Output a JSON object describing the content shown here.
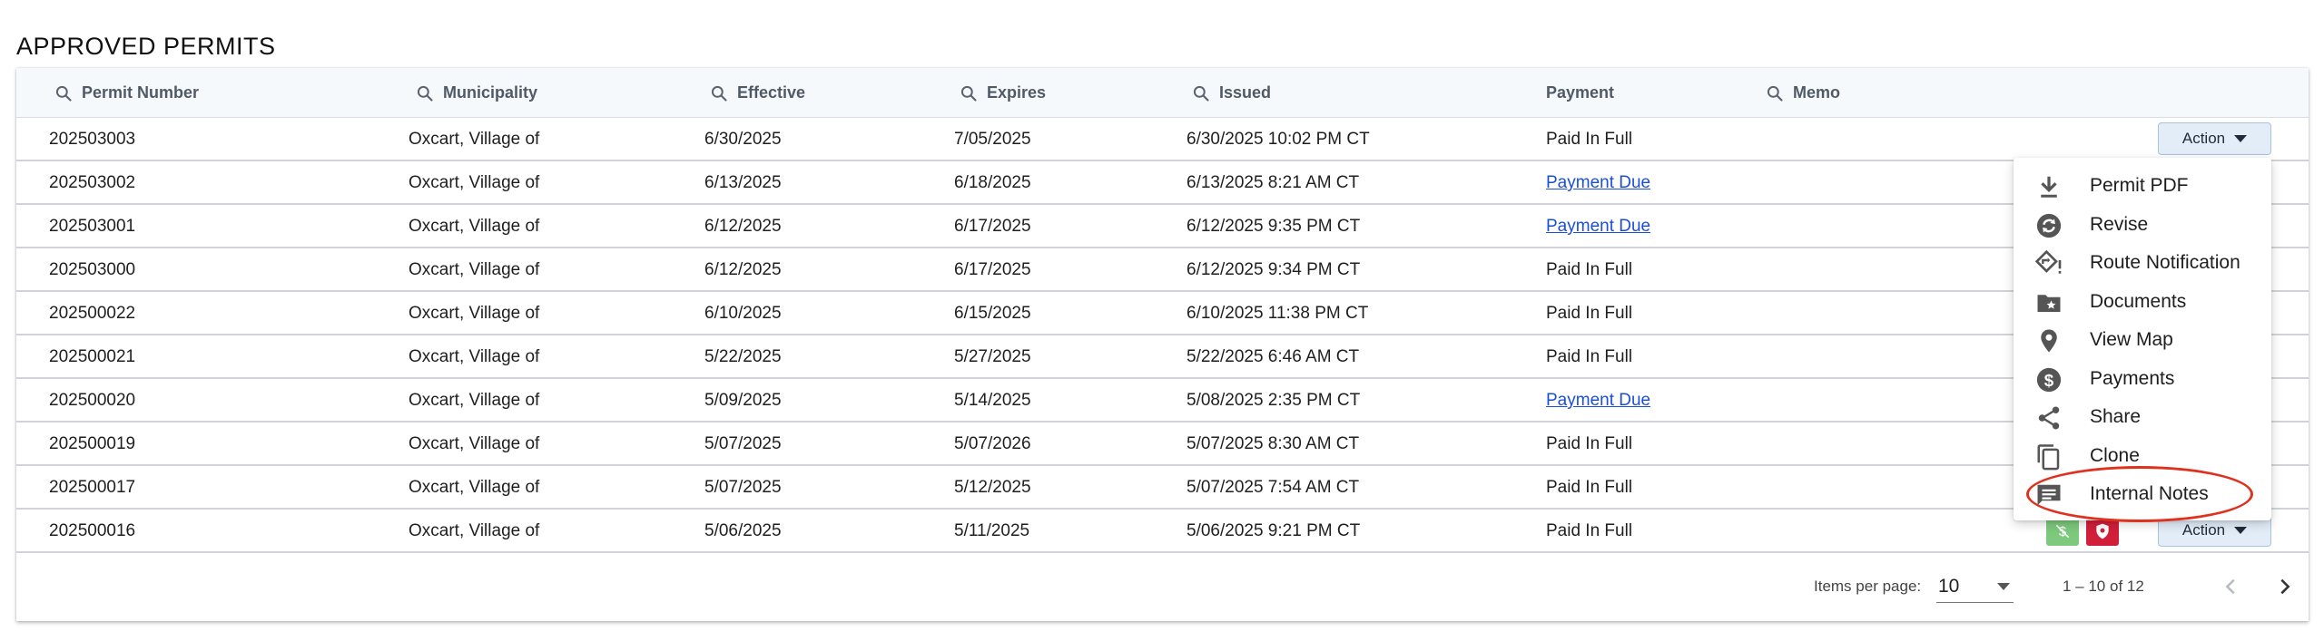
{
  "page": {
    "title": "APPROVED PERMITS"
  },
  "columns": {
    "permit_number": "Permit Number",
    "municipality": "Municipality",
    "effective": "Effective",
    "expires": "Expires",
    "issued": "Issued",
    "payment": "Payment",
    "memo": "Memo"
  },
  "rows": [
    {
      "permit": "202503003",
      "municipality": "Oxcart, Village of",
      "effective": "6/30/2025",
      "expires": "7/05/2025",
      "issued": "6/30/2025 10:02 PM CT",
      "payment": "Paid In Full",
      "payment_link": false
    },
    {
      "permit": "202503002",
      "municipality": "Oxcart, Village of",
      "effective": "6/13/2025",
      "expires": "6/18/2025",
      "issued": "6/13/2025 8:21 AM CT",
      "payment": "Payment Due",
      "payment_link": true
    },
    {
      "permit": "202503001",
      "municipality": "Oxcart, Village of",
      "effective": "6/12/2025",
      "expires": "6/17/2025",
      "issued": "6/12/2025 9:35 PM CT",
      "payment": "Payment Due",
      "payment_link": true
    },
    {
      "permit": "202503000",
      "municipality": "Oxcart, Village of",
      "effective": "6/12/2025",
      "expires": "6/17/2025",
      "issued": "6/12/2025 9:34 PM CT",
      "payment": "Paid In Full",
      "payment_link": false
    },
    {
      "permit": "202500022",
      "municipality": "Oxcart, Village of",
      "effective": "6/10/2025",
      "expires": "6/15/2025",
      "issued": "6/10/2025 11:38 PM CT",
      "payment": "Paid In Full",
      "payment_link": false
    },
    {
      "permit": "202500021",
      "municipality": "Oxcart, Village of",
      "effective": "5/22/2025",
      "expires": "5/27/2025",
      "issued": "5/22/2025 6:46 AM CT",
      "payment": "Paid In Full",
      "payment_link": false
    },
    {
      "permit": "202500020",
      "municipality": "Oxcart, Village of",
      "effective": "5/09/2025",
      "expires": "5/14/2025",
      "issued": "5/08/2025 2:35 PM CT",
      "payment": "Payment Due",
      "payment_link": true
    },
    {
      "permit": "202500019",
      "municipality": "Oxcart, Village of",
      "effective": "5/07/2025",
      "expires": "5/07/2026",
      "issued": "5/07/2025 8:30 AM CT",
      "payment": "Paid In Full",
      "payment_link": false
    },
    {
      "permit": "202500017",
      "municipality": "Oxcart, Village of",
      "effective": "5/07/2025",
      "expires": "5/12/2025",
      "issued": "5/07/2025 7:54 AM CT",
      "payment": "Paid In Full",
      "payment_link": false
    },
    {
      "permit": "202500016",
      "municipality": "Oxcart, Village of",
      "effective": "5/06/2025",
      "expires": "5/11/2025",
      "issued": "5/06/2025 9:21 PM CT",
      "payment": "Paid In Full",
      "payment_link": false
    }
  ],
  "action_button": {
    "label": "Action"
  },
  "action_menu": {
    "items": [
      {
        "label": "Permit PDF",
        "icon": "download-icon"
      },
      {
        "label": "Revise",
        "icon": "revise-icon"
      },
      {
        "label": "Route Notification",
        "icon": "route-notification-icon"
      },
      {
        "label": "Documents",
        "icon": "folder-star-icon"
      },
      {
        "label": "View Map",
        "icon": "map-pin-icon"
      },
      {
        "label": "Payments",
        "icon": "dollar-circle-icon"
      },
      {
        "label": "Share",
        "icon": "share-icon"
      },
      {
        "label": "Clone",
        "icon": "copy-icon"
      },
      {
        "label": "Internal Notes",
        "icon": "notes-icon"
      }
    ],
    "highlighted_item": "Internal Notes"
  },
  "footer": {
    "items_per_page_label": "Items per page:",
    "items_per_page_value": "10",
    "range_label": "1 – 10 of 12"
  },
  "colors": {
    "header_bg": "#f6f9fc",
    "link": "#1a4fd6",
    "action_bg": "#e3edf8",
    "highlight_ring": "#e0311f",
    "status_green": "#7dc97d",
    "status_red": "#d11f3a"
  }
}
